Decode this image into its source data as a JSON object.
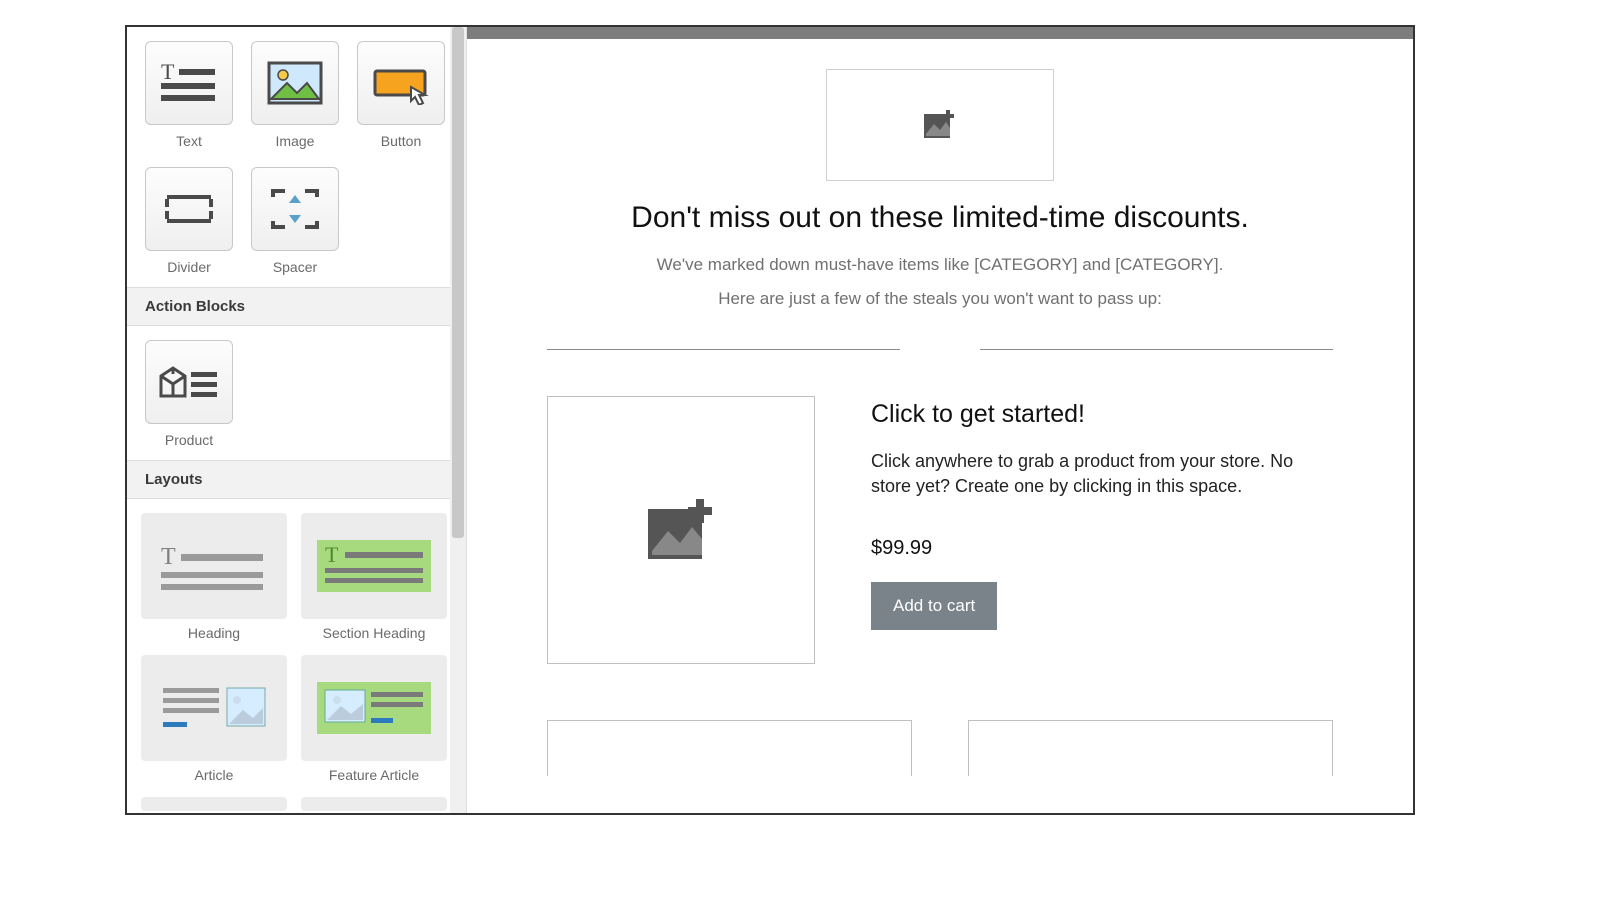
{
  "sidebar": {
    "content_blocks": [
      {
        "id": "text",
        "label": "Text"
      },
      {
        "id": "image",
        "label": "Image"
      },
      {
        "id": "button",
        "label": "Button"
      },
      {
        "id": "divider",
        "label": "Divider"
      },
      {
        "id": "spacer",
        "label": "Spacer"
      }
    ],
    "action_section_label": "Action Blocks",
    "action_blocks": [
      {
        "id": "product",
        "label": "Product"
      }
    ],
    "layouts_section_label": "Layouts",
    "layouts": [
      {
        "id": "heading",
        "label": "Heading"
      },
      {
        "id": "section-heading",
        "label": "Section Heading"
      },
      {
        "id": "article",
        "label": "Article"
      },
      {
        "id": "feature-article",
        "label": "Feature Article"
      }
    ]
  },
  "canvas": {
    "headline": "Don't miss out on these limited-time discounts.",
    "subline1": "We've marked down must-have items like [CATEGORY] and [CATEGORY].",
    "subline2": "Here are just a few of the steals you won't want to pass up:",
    "product": {
      "title": "Click to get started!",
      "description": "Click anywhere to grab a product from your store. No store yet? Create one by clicking in this space.",
      "price": "$99.99",
      "cta_label": "Add to cart"
    }
  },
  "icons": {
    "add_image": "add-image-icon"
  },
  "colors": {
    "tile_border": "#c8c8c8",
    "accent_green": "#a7da7e",
    "button_orange": "#f6a31f",
    "canvas_topbar": "#7d7d7d",
    "atc_button": "#7a828a"
  }
}
